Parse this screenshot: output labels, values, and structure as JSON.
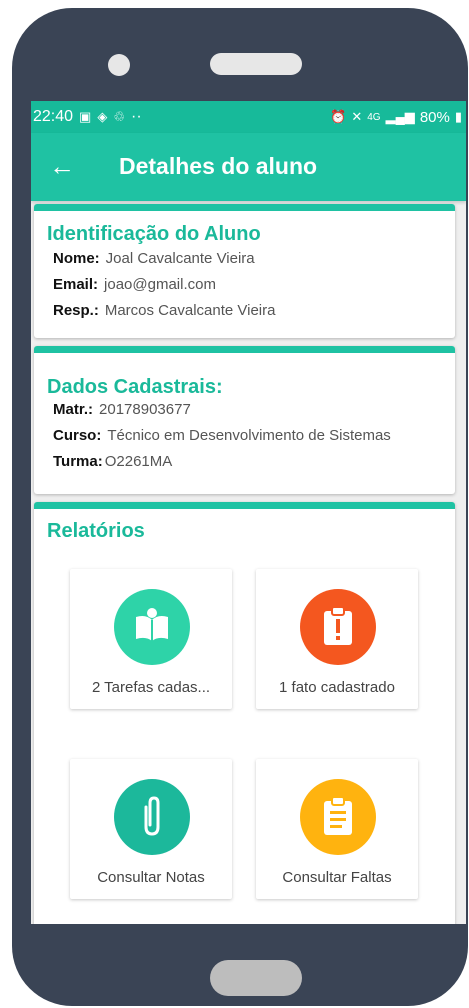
{
  "status": {
    "time": "22:40",
    "extra": "··",
    "network": "4G",
    "battery": "80%"
  },
  "appbar": {
    "title": "Detalhes do aluno"
  },
  "identificacao": {
    "title": "Identificação do Aluno",
    "fields": [
      {
        "label": "Nome:",
        "value": "Joal Cavalcante Vieira"
      },
      {
        "label": "Email:",
        "value": "joao@gmail.com"
      },
      {
        "label": "Resp.:",
        "value": "Marcos Cavalcante Vieira"
      }
    ]
  },
  "cadastrais": {
    "title": "Dados Cadastrais:",
    "fields": [
      {
        "label": "Matr.:",
        "value": "20178903677"
      },
      {
        "label": "Curso:",
        "value": "Técnico em Desenvolvimento de Sistemas"
      },
      {
        "label": "Turma:",
        "value": "O2261MA"
      }
    ]
  },
  "relatorios": {
    "title": "Relatórios",
    "tiles": [
      {
        "label": "2 Tarefas cadas...",
        "icon": "book-icon",
        "color": "#2ed3a8"
      },
      {
        "label": "1 fato cadastrado",
        "icon": "alert-clipboard-icon",
        "color": "#f4571f"
      },
      {
        "label": "Consultar Notas",
        "icon": "paperclip-icon",
        "color": "#1cb89b"
      },
      {
        "label": "Consultar Faltas",
        "icon": "clipboard-icon",
        "color": "#ffb30f"
      }
    ]
  },
  "colors": {
    "primary": "#1fc2a3",
    "statusbar": "#17ba9a",
    "phone_body": "#3a4455"
  }
}
